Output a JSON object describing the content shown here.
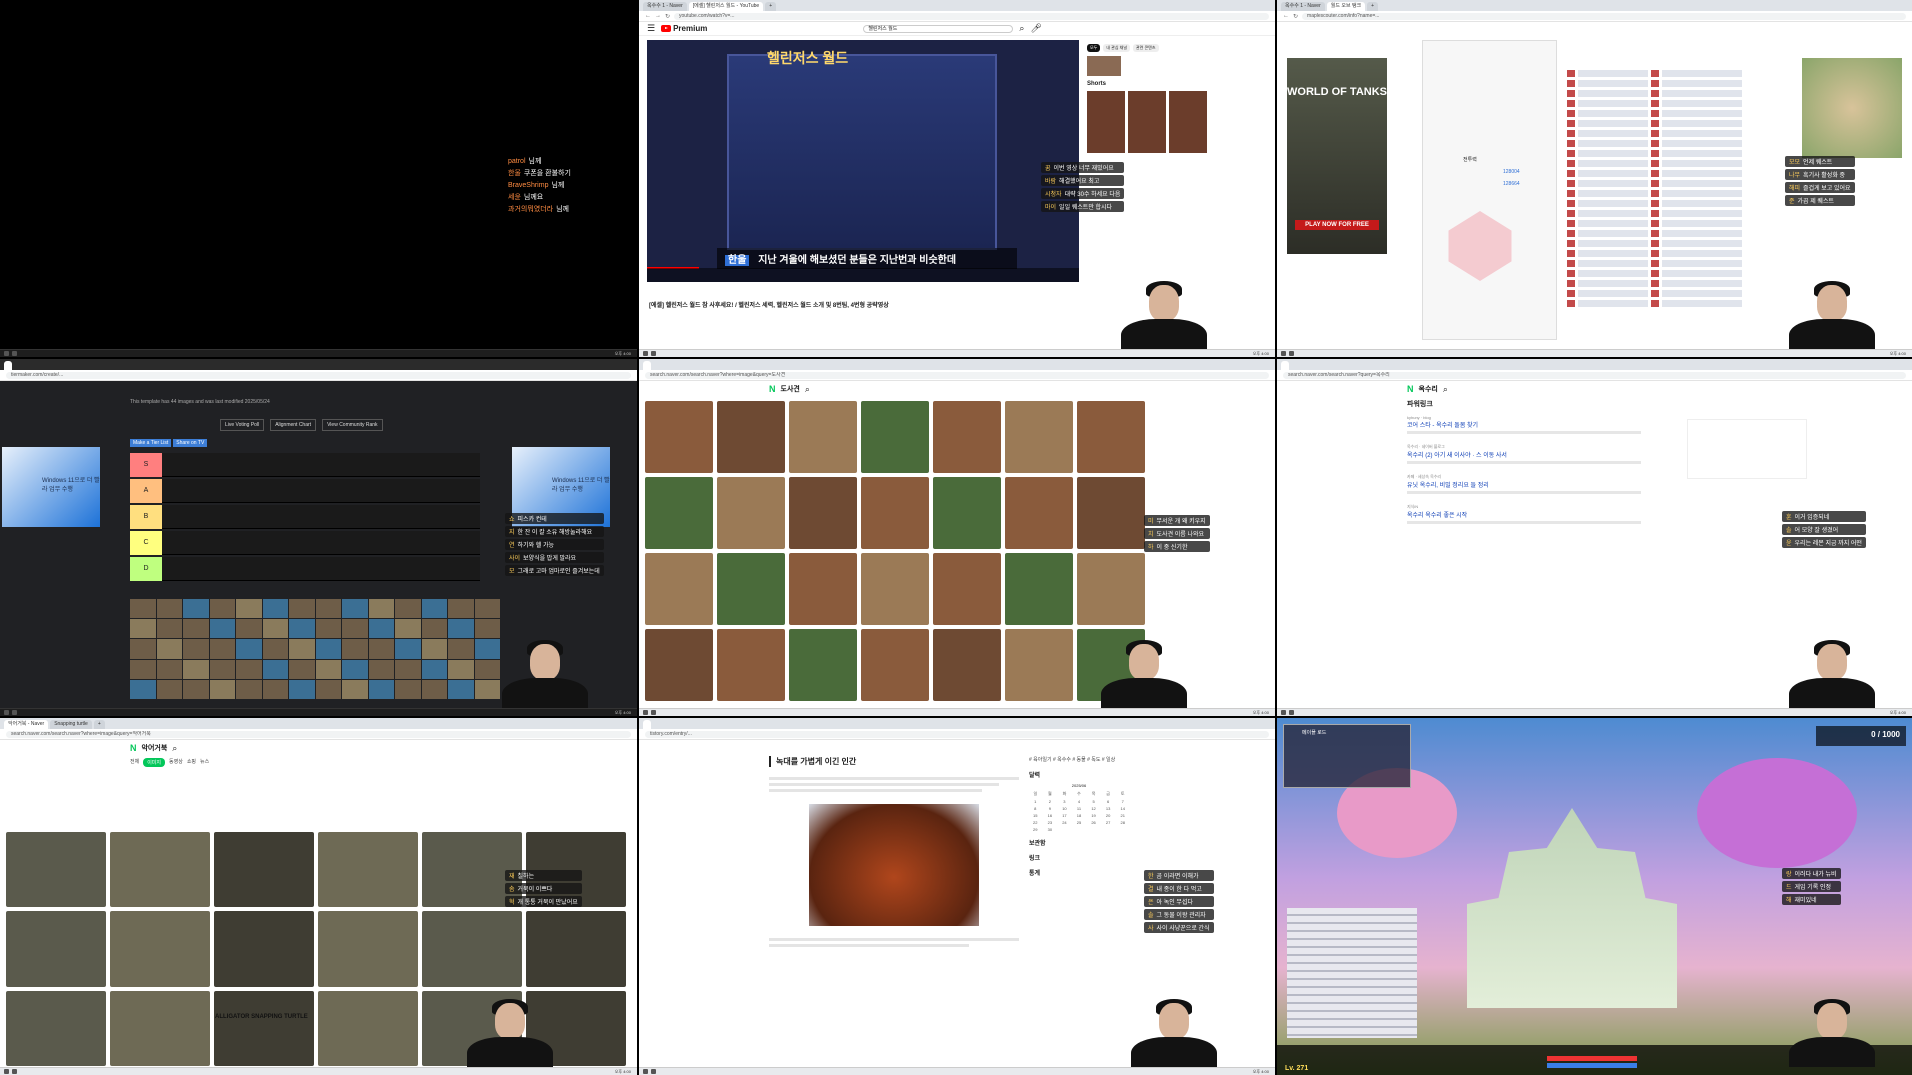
{
  "taskbar": {
    "clock": "오후 4:00"
  },
  "cell0": {
    "chat": [
      {
        "user": "patrol",
        "text": "님께"
      },
      {
        "user": "한울",
        "text": "쿠폰을 환불하기"
      },
      {
        "user": "BraveShrimp",
        "text": "님께"
      },
      {
        "user": "세윤",
        "text": "님께요"
      },
      {
        "user": "과거의뭐였더라",
        "text": "님께"
      }
    ]
  },
  "cell1": {
    "tabs": [
      "옥수수 1 - Naver",
      "[에셀] 헬린저스 월드 - YouTube",
      "+"
    ],
    "url": "youtube.com/watch?v=...",
    "logo": "Premium",
    "search": "헬린저스 월드",
    "video_title": "헬린저스 월드",
    "subtitle_speaker": "한울",
    "subtitle": "지난 겨울에 해보셨던 분들은 지난번과 비슷한데",
    "page_title": "[에셀] 헬린저스 월드 참 사후세요! / 헬린저스 세력, 헬린저스 월드 소개 및 8번팀, 4번형 공략영상",
    "progress": 0.12,
    "chips": [
      "모두",
      "내 관심 채널",
      "관련 콘텐츠"
    ],
    "shorts_label": "Shorts",
    "chat": [
      {
        "user": "꿈",
        "text": "이번 영상 너무 재밌어요"
      },
      {
        "user": "바람",
        "text": "해결했어요 최고"
      },
      {
        "user": "시청자",
        "text": "대략 30수 하세요 다음"
      },
      {
        "user": "마이",
        "text": "일일 퀘스트만 합시다"
      }
    ]
  },
  "cell2": {
    "tabs": [
      "옥수수 1 - Naver",
      "월드 오브 탱크",
      "+"
    ],
    "url": "maplescouter.com/info?name=...",
    "ad_logo": "WORLD OF TANKS",
    "ad_cta": "PLAY NOW FOR FREE",
    "stats": [
      "전투력",
      "128004",
      "128664"
    ],
    "chat": [
      {
        "user": "모모",
        "text": "언제 퀘스트"
      },
      {
        "user": "나무",
        "text": "흑기사 활성화 중"
      },
      {
        "user": "해피",
        "text": "즐겁게 보고 있어요"
      },
      {
        "user": "준",
        "text": "가끔 제 퀘스트"
      }
    ]
  },
  "cell3": {
    "url": "tiermaker.com/create/...",
    "caption": "This template has 44 images and was last modified 2025/05/24",
    "buttons": [
      "Live Voting Poll",
      "Alignment Chart",
      "View Community Rank"
    ],
    "tabs": [
      "Make a Tier List",
      "Share on TV"
    ],
    "tiers": [
      {
        "label": "S",
        "color": "#ff7f7f"
      },
      {
        "label": "A",
        "color": "#ffbf7f"
      },
      {
        "label": "B",
        "color": "#ffdf7f"
      },
      {
        "label": "C",
        "color": "#ffff7f"
      },
      {
        "label": "D",
        "color": "#bfff7f"
      }
    ],
    "ad_text": "Windows 11으로 더 빨라 업무 수행",
    "chat": [
      {
        "user": "쇼",
        "text": "피스카 컨테"
      },
      {
        "user": "지",
        "text": "한 잔 이 칼 소유 해방눌라해요"
      },
      {
        "user": "연",
        "text": "하기와 헬 가능"
      },
      {
        "user": "사이",
        "text": "보양식을 밥게 말라요"
      },
      {
        "user": "모",
        "text": "그래로 고마 엄마로인 즐겨보는데"
      }
    ]
  },
  "cell4": {
    "url": "search.naver.com/search.naver?where=image&query=도사견",
    "logo": "N",
    "query": "도사견",
    "chat": [
      {
        "user": "미",
        "text": "무서운 개 왜 키우지"
      },
      {
        "user": "치",
        "text": "도사견 이름 나와요"
      },
      {
        "user": "하",
        "text": "이 중 신기한"
      }
    ]
  },
  "cell5": {
    "url": "search.naver.com/search.naver?query=옥수리",
    "logo": "N",
    "query": "옥수리",
    "section": "파워링크",
    "results": [
      {
        "src": "kyhuny · blog",
        "title": "코어 스타 - 옥수리 돌봄 찾기"
      },
      {
        "src": "옥수리 · 네이버 블로그",
        "title": "옥수리 (2) 아기 새 이사야 · 스 이동 사서"
      },
      {
        "src": "카페 · 세상속 옥수리",
        "title": "유닛 옥수리, 비밀 정리요 들 정리"
      },
      {
        "src": "지식iN",
        "title": "옥수리 옥수리 좋은 시작"
      }
    ],
    "chat": [
      {
        "user": "훈",
        "text": "이거 입증되네"
      },
      {
        "user": "솔",
        "text": "어 모양 잘 생겼어"
      },
      {
        "user": "윤",
        "text": "우리는 레몬 지금 까지 어떤"
      }
    ]
  },
  "cell6": {
    "tabs": [
      "악어거북 - Naver",
      "Snapping turtle",
      "+"
    ],
    "url": "search.naver.com/search.naver?where=image&query=악어거북",
    "logo": "N",
    "query": "악어거북",
    "filters": [
      "전체",
      "이미지",
      "동영상",
      "쇼핑",
      "뉴스"
    ],
    "overlay_label": "ALLIGATOR SNAPPING TURTLE",
    "chat": [
      {
        "user": "재",
        "text": "칠하는"
      },
      {
        "user": "솜",
        "text": "거북이 이쁘다"
      },
      {
        "user": "혁",
        "text": "개 통통 거북이 만났어요"
      }
    ]
  },
  "cell7": {
    "url": "tistory.com/entry/...",
    "title": "녹대를 가볍게 이긴 인간",
    "side_headers": [
      "달력",
      "보관함",
      "링크",
      "통계"
    ],
    "month": "2025/06",
    "weekdays": [
      "일",
      "월",
      "화",
      "수",
      "목",
      "금",
      "토"
    ],
    "tags": "# 육아일기  # 옥수수  # 동물  # 독도  # 일상",
    "chat": [
      {
        "user": "한",
        "text": "곰 이라면 이해가"
      },
      {
        "user": "결",
        "text": "내 종이 한 다 먹고"
      },
      {
        "user": "은",
        "text": "아 녹인 무섭다"
      },
      {
        "user": "솔",
        "text": "그 동물 이왕 관리자"
      },
      {
        "user": "사",
        "text": "사이 사냥꾼으로 간식"
      }
    ]
  },
  "cell8": {
    "map_name": "메이플 로드",
    "level": "Lv. 271",
    "top_right": "0 / 1000",
    "chat": [
      {
        "user": "랑",
        "text": "이러다 내가 뉴비"
      },
      {
        "user": "드",
        "text": "게임 기록 인정"
      },
      {
        "user": "해",
        "text": "재미있네"
      }
    ]
  }
}
